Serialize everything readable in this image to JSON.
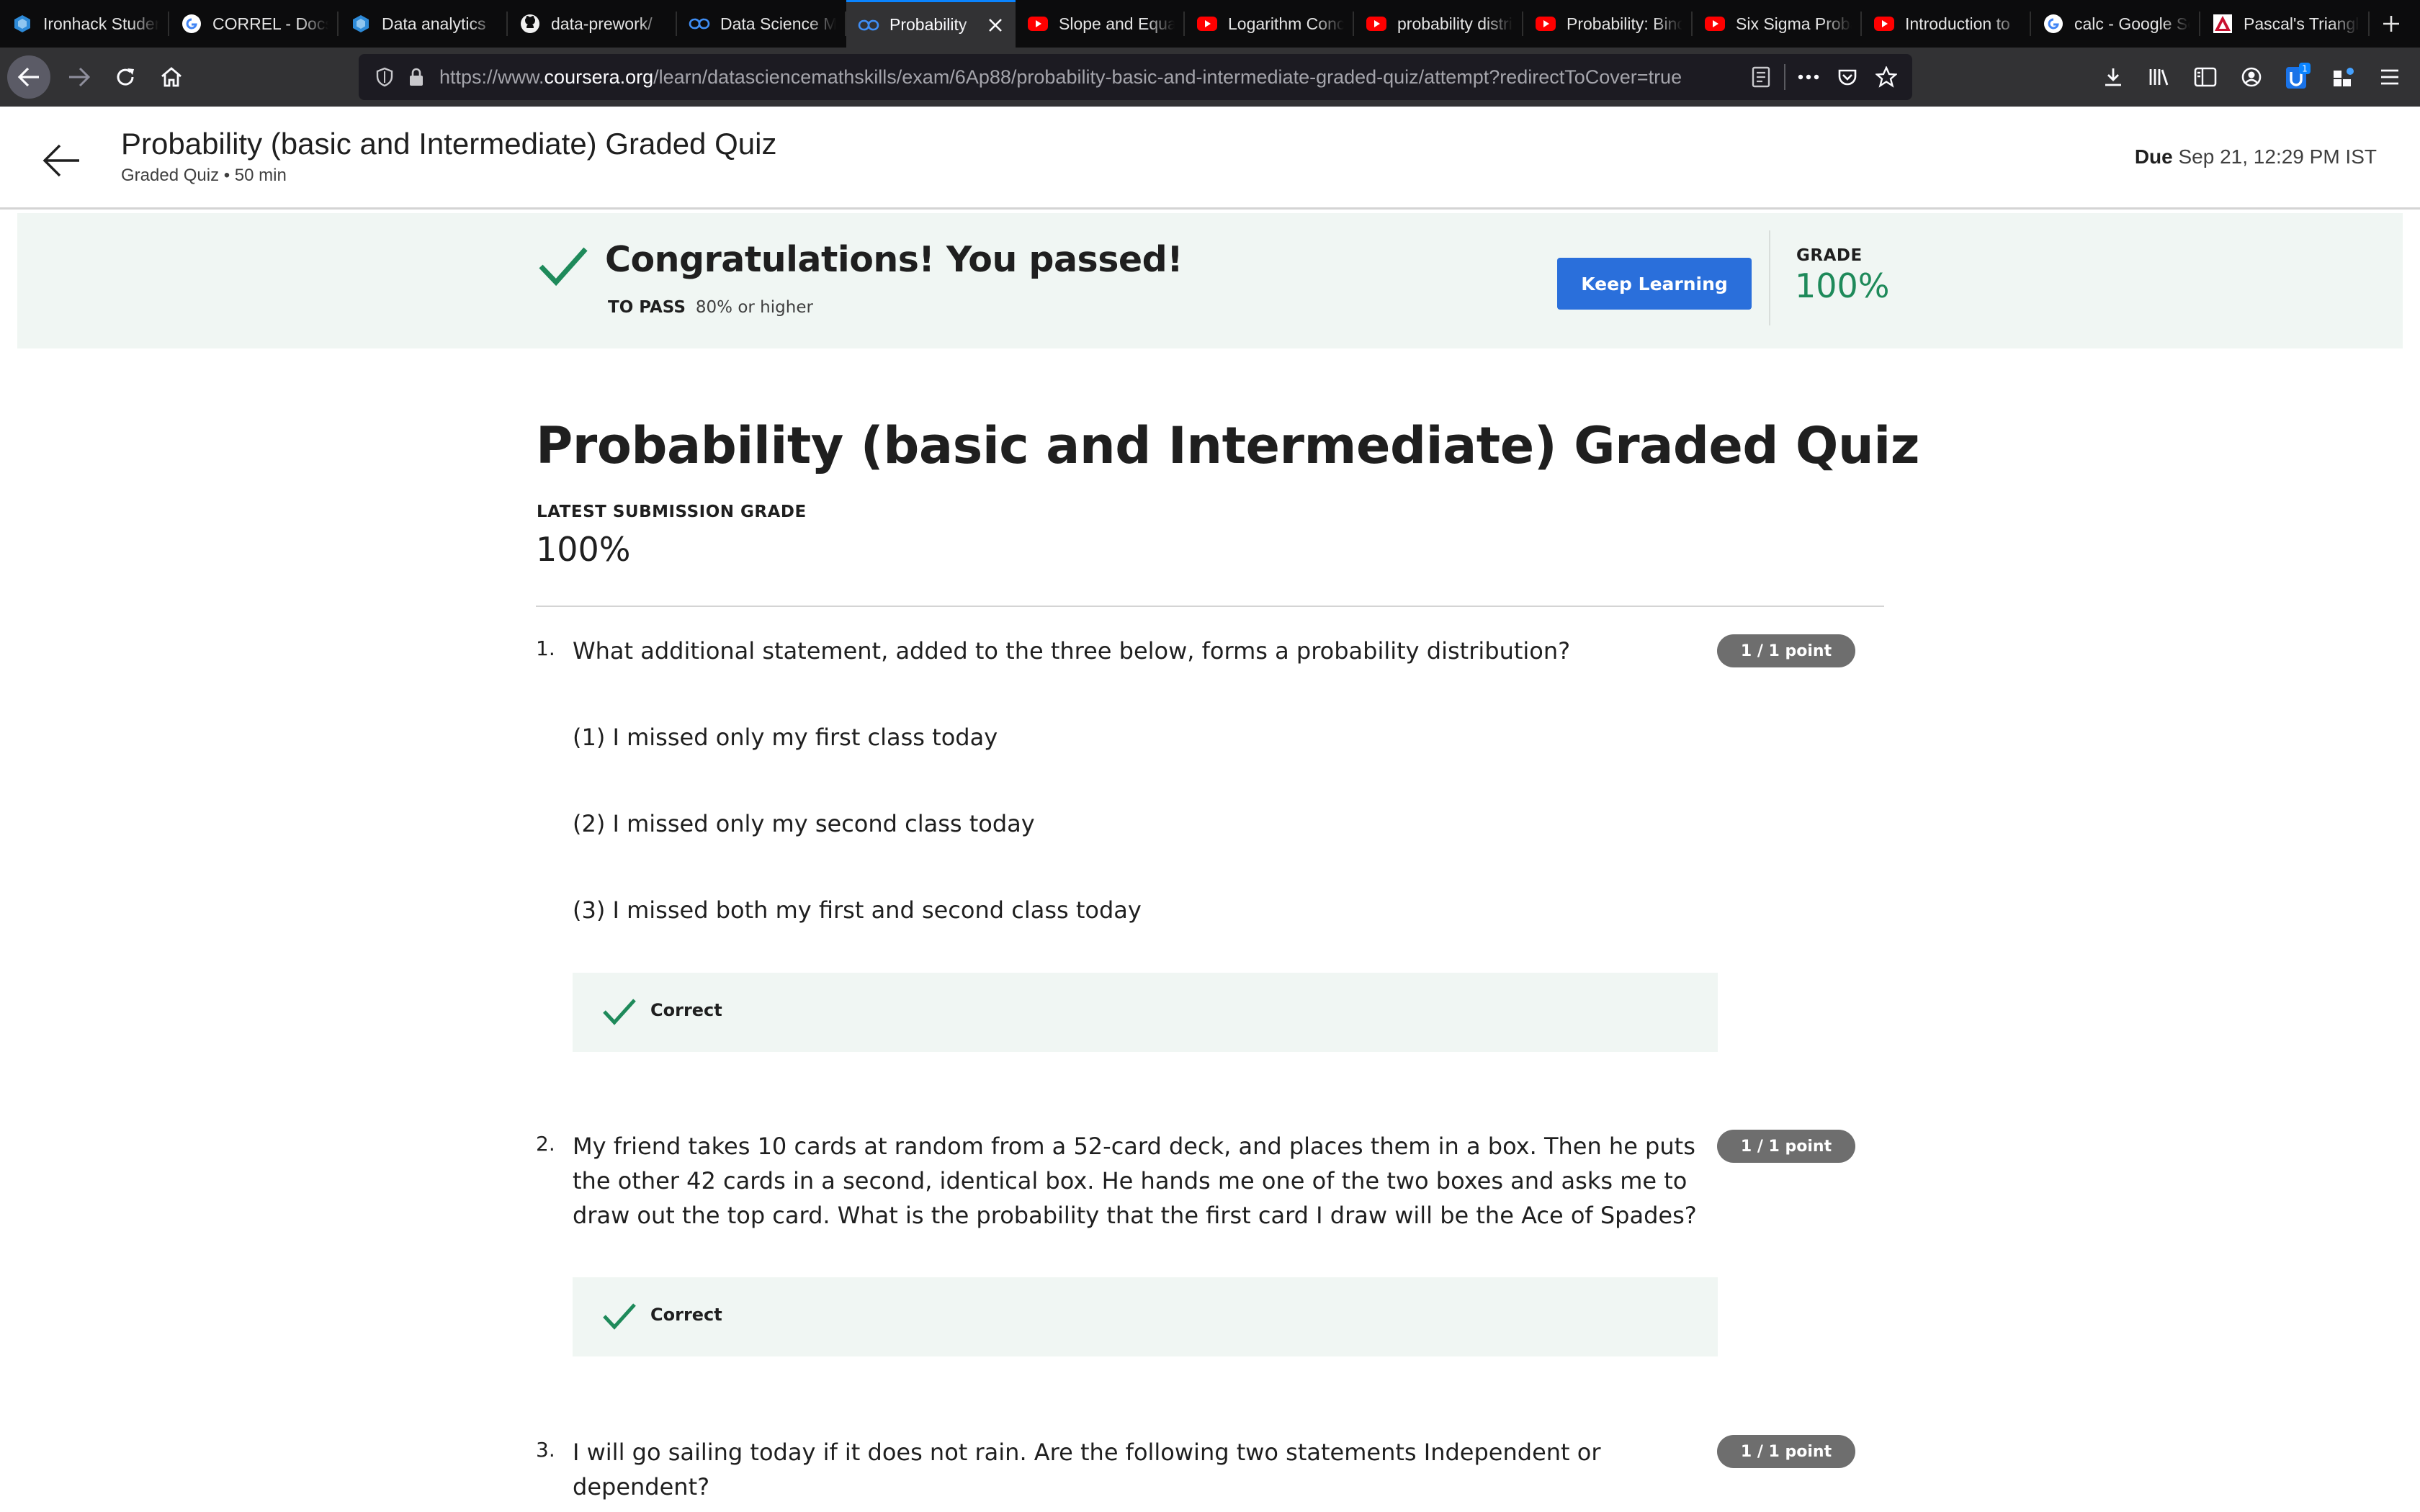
{
  "browser": {
    "tabs": [
      {
        "title": "Ironhack Student Portal",
        "icon": "ironhack-icon",
        "active": false
      },
      {
        "title": "CORREL - Docs Editors Help",
        "icon": "google-icon",
        "active": false
      },
      {
        "title": "Data analytics",
        "icon": "ironhack-icon",
        "active": false
      },
      {
        "title": "data-prework/",
        "icon": "github-icon",
        "active": false
      },
      {
        "title": "Data Science Math Skills",
        "icon": "coursera-icon",
        "active": false
      },
      {
        "title": "Probability",
        "icon": "coursera-icon",
        "active": true
      },
      {
        "title": "Slope and Equation",
        "icon": "youtube-icon",
        "active": false
      },
      {
        "title": "Logarithm Concepts",
        "icon": "youtube-icon",
        "active": false
      },
      {
        "title": "probability distribution",
        "icon": "youtube-icon",
        "active": false
      },
      {
        "title": "Probability: Binomial",
        "icon": "youtube-icon",
        "active": false
      },
      {
        "title": "Six Sigma Probability",
        "icon": "youtube-icon",
        "active": false
      },
      {
        "title": "Introduction to",
        "icon": "youtube-icon",
        "active": false
      },
      {
        "title": "calc - Google Search",
        "icon": "google-icon",
        "active": false
      },
      {
        "title": "Pascal's Triangle",
        "icon": "pascal-icon",
        "active": false
      }
    ],
    "url_prefix": "https://www.",
    "url_domain": "coursera.org",
    "url_path": "/learn/datasciencemathskills/exam/6Ap88/probability-basic-and-intermediate-graded-quiz/attempt?redirectToCover=true",
    "extension_badge": "1"
  },
  "header": {
    "title": "Probability (basic and Intermediate) Graded Quiz",
    "subtitle": "Graded Quiz • 50 min",
    "due_label": "Due",
    "due_value": "Sep 21, 12:29 PM IST"
  },
  "banner": {
    "message": "Congratulations! You passed!",
    "to_pass_label": "TO PASS",
    "to_pass_value": "80% or higher",
    "button_label": "Keep Learning",
    "grade_label": "GRADE",
    "grade_value": "100%"
  },
  "main": {
    "title": "Probability (basic and Intermediate) Graded Quiz",
    "latest_grade_label": "LATEST SUBMISSION GRADE",
    "latest_grade_value": "100%"
  },
  "questions": [
    {
      "number": "1.",
      "text": "What additional statement, added to the three below, forms a probability distribution?",
      "points": "1 / 1 point",
      "options": [
        "(1) I missed only my first class today",
        "(2) I missed only my second class today",
        "(3) I missed both my first and second class today"
      ],
      "feedback": "Correct"
    },
    {
      "number": "2.",
      "text": "My friend takes 10 cards at random from a 52-card deck, and places them in a box. Then he puts the other 42 cards in a second, identical box. He hands me one of the two boxes and asks me to draw out the top card. What is the probability that the first card I draw will be the Ace of Spades?",
      "points": "1 / 1 point",
      "feedback": "Correct"
    },
    {
      "number": "3.",
      "text": "I will go sailing today if it does not rain. Are the following two statements Independent or dependent?",
      "points": "1 / 1 point"
    }
  ],
  "colors": {
    "accent": "#2a6fdb",
    "success": "#1e8a5a",
    "banner_bg": "#f0f6f3",
    "badge_bg": "#6e6e6e",
    "tab_bar": "#0c0c0d",
    "nav_bar": "#323234"
  }
}
